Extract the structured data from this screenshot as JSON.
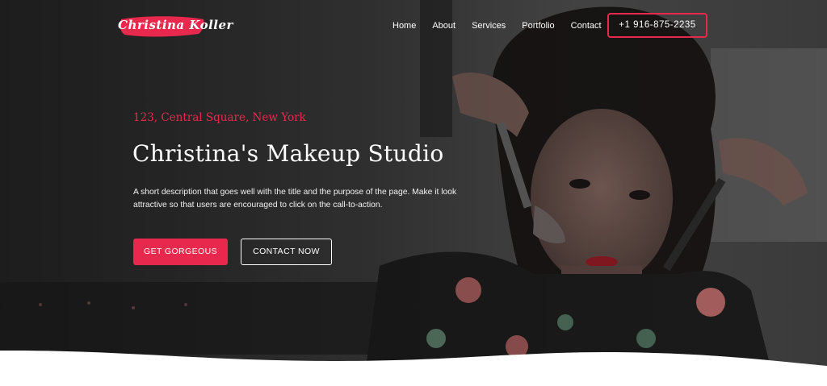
{
  "brand": {
    "logo_text": "Christina Koller",
    "accent_color": "#e8284d"
  },
  "nav": {
    "items": [
      {
        "label": "Home"
      },
      {
        "label": "About"
      },
      {
        "label": "Services"
      },
      {
        "label": "Portfolio"
      },
      {
        "label": "Contact"
      }
    ],
    "phone": "+1 916-875-2235"
  },
  "hero": {
    "address": "123, Central Square, New York",
    "title": "Christina's Makeup Studio",
    "description": "A short description that goes well with the title and the purpose of the page. Make it look attractive so that users are encouraged to click on the call-to-action.",
    "primary_cta": "GET GORGEOUS",
    "secondary_cta": "CONTACT NOW"
  }
}
